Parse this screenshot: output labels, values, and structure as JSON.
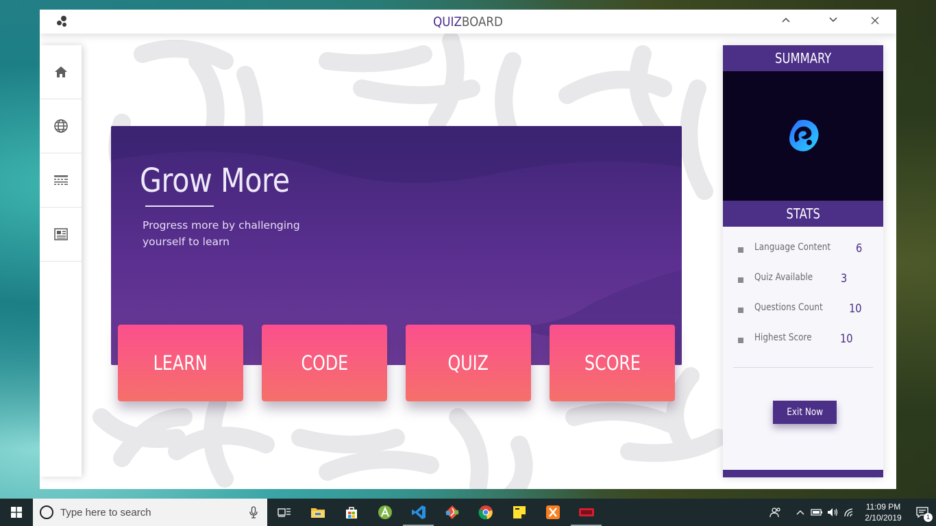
{
  "window": {
    "title_part1": "QUIZ",
    "title_part2": "BOARD",
    "buttons": [
      {
        "name": "minimize-up-button",
        "icon": "chevron-up-icon"
      },
      {
        "name": "chevron-down-button",
        "icon": "chevron-down-icon"
      },
      {
        "name": "close-button",
        "icon": "close-icon"
      }
    ]
  },
  "sidebar": {
    "items": [
      {
        "name": "home",
        "icon": "home-icon"
      },
      {
        "name": "globe",
        "icon": "globe-icon"
      },
      {
        "name": "list",
        "icon": "list-icon"
      },
      {
        "name": "news",
        "icon": "newspaper-icon"
      }
    ]
  },
  "hero": {
    "title": "Grow More",
    "subtitle": "Progress more by challenging yourself to learn"
  },
  "tiles": [
    {
      "label": "LEARN"
    },
    {
      "label": "CODE"
    },
    {
      "label": "QUIZ"
    },
    {
      "label": "SCORE"
    }
  ],
  "panel": {
    "summary_title": "SUMMARY",
    "stats_title": "STATS",
    "stats": [
      {
        "label": "Language Content",
        "value": "6"
      },
      {
        "label": "Quiz Available",
        "value": "3"
      },
      {
        "label": "Questions Count",
        "value": "10"
      },
      {
        "label": "Highest Score",
        "value": "10"
      }
    ],
    "exit_label": "Exit Now"
  },
  "taskbar": {
    "search_placeholder": "Type here to search",
    "time": "11:09 PM",
    "date": "2/10/2019",
    "notification_count": "1",
    "apps": [
      "task-view-icon",
      "file-explorer-icon",
      "store-icon",
      "android-studio-icon",
      "vscode-icon",
      "git-icon",
      "chrome-icon",
      "sticky-notes-icon",
      "xampp-icon",
      "quizboard-app-icon"
    ]
  },
  "colors": {
    "brand_purple": "#4c2f86",
    "tile_pink": "#fb4f8e",
    "tile_coral": "#f6706a"
  }
}
